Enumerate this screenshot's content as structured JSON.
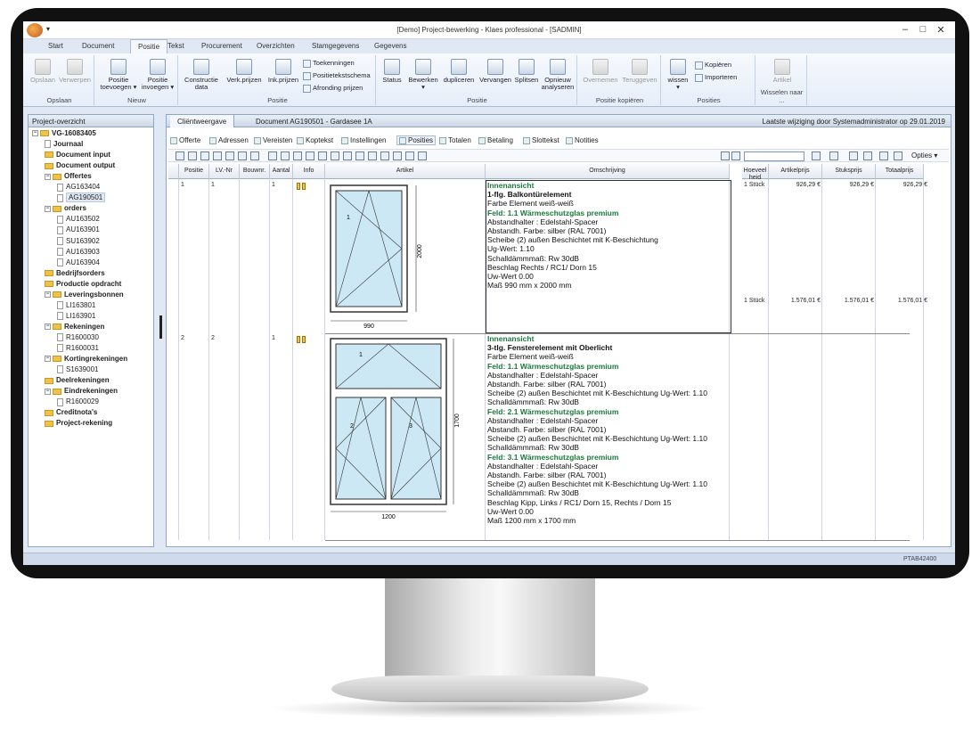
{
  "window": {
    "title": "[Demo] Project-bewerking - Klaes professional - [SADMIN]",
    "quick_access": "▾"
  },
  "menu_tabs": [
    "Start",
    "Document",
    "Positie",
    "Tekst",
    "Procurement",
    "Overzichten",
    "Stamgegevens",
    "Gegevens"
  ],
  "ribbon": {
    "buttons": {
      "opslaan": "Opslaan",
      "verwerpen": "Verwerpen",
      "positie_toevoegen": "Positie\ntoevoegen ▾",
      "positie_invoegen": "Positie\ninvoegen ▾",
      "constructie_data": "Constructie\ndata",
      "verk_prijzen": "Verk.prijzen",
      "ink_prijzen": "Ink.prijzen",
      "toekenningen": "Toekenningen",
      "positietekstschema": "Positietekstschema",
      "afronding_prijzen": "Afronding prijzen",
      "status": "Status",
      "bewerken": "Bewerken\n▾",
      "dupliceren": "dupliceren",
      "vervangen": "Vervangen",
      "splitsen": "Splitsen",
      "opnieuw_analyseren": "Opnieuw\nanalyseren",
      "overnemen": "Overnemen",
      "teruggeven": "Teruggeven",
      "wissen": "wissen\n▾",
      "kopieren": "Kopiëren",
      "importeren": "Importeren",
      "artikel": "Artikel"
    },
    "groups": {
      "opslaan": "Opslaan",
      "nieuw": "Nieuw",
      "positie": "Positie",
      "positie2": "Positie",
      "positie_kopieren": "Positie kopiëren",
      "posities": "Posities",
      "wisselen": "Wisselen naar ..."
    }
  },
  "left_panel": {
    "title": "Project-overzicht",
    "tree": [
      {
        "label": "VG-16083405",
        "level": 0,
        "bold": true,
        "folder": true,
        "box": "−"
      },
      {
        "label": "Journaal",
        "level": 1,
        "bold": true,
        "folder": false
      },
      {
        "label": "Document input",
        "level": 1,
        "bold": true,
        "folder": true
      },
      {
        "label": "Document output",
        "level": 1,
        "bold": true,
        "folder": true
      },
      {
        "label": "Offertes",
        "level": 1,
        "bold": true,
        "folder": true,
        "box": "−"
      },
      {
        "label": "AG163404",
        "level": 2,
        "bold": false,
        "folder": false
      },
      {
        "label": "AG190501",
        "level": 2,
        "bold": false,
        "folder": false,
        "selected": true
      },
      {
        "label": "orders",
        "level": 1,
        "bold": true,
        "folder": true,
        "box": "−"
      },
      {
        "label": "AU163502",
        "level": 2,
        "bold": false,
        "folder": false
      },
      {
        "label": "AU163901",
        "level": 2,
        "bold": false,
        "folder": false
      },
      {
        "label": "SU163902",
        "level": 2,
        "bold": false,
        "folder": false
      },
      {
        "label": "AU163903",
        "level": 2,
        "bold": false,
        "folder": false
      },
      {
        "label": "AU163904",
        "level": 2,
        "bold": false,
        "folder": false
      },
      {
        "label": "Bedrijfsorders",
        "level": 1,
        "bold": true,
        "folder": true
      },
      {
        "label": "Productie opdracht",
        "level": 1,
        "bold": true,
        "folder": true
      },
      {
        "label": "Leveringsbonnen",
        "level": 1,
        "bold": true,
        "folder": true,
        "box": "−"
      },
      {
        "label": "LI163801",
        "level": 2,
        "bold": false,
        "folder": false
      },
      {
        "label": "LI163901",
        "level": 2,
        "bold": false,
        "folder": false
      },
      {
        "label": "Rekeningen",
        "level": 1,
        "bold": true,
        "folder": true,
        "box": "−"
      },
      {
        "label": "R1600030",
        "level": 2,
        "bold": false,
        "folder": false
      },
      {
        "label": "R1600031",
        "level": 2,
        "bold": false,
        "folder": false
      },
      {
        "label": "Kortingrekeningen",
        "level": 1,
        "bold": true,
        "folder": true,
        "box": "−"
      },
      {
        "label": "S1639001",
        "level": 2,
        "bold": false,
        "folder": false
      },
      {
        "label": "Deelrekeningen",
        "level": 1,
        "bold": true,
        "folder": true
      },
      {
        "label": "Eindrekeningen",
        "level": 1,
        "bold": true,
        "folder": true,
        "box": "−"
      },
      {
        "label": "R1600029",
        "level": 2,
        "bold": false,
        "folder": false
      },
      {
        "label": "Creditnota's",
        "level": 1,
        "bold": true,
        "folder": true
      },
      {
        "label": "Project-rekening",
        "level": 1,
        "bold": true,
        "folder": true
      }
    ]
  },
  "main": {
    "view_tab": "Cliëntweergave",
    "document": "Document AG190501 - Gardasee 1A",
    "last_change": "Laatste wijziging door Systemadministrator op 29.01.2019",
    "subtabs": [
      "Offerte",
      "Adressen",
      "Vereisten",
      "Koptekst",
      "Instellingen",
      "Posities",
      "Totalen",
      "Betaling",
      "Slottekst",
      "Notities"
    ],
    "options": "Opties ▾",
    "columns": {
      "positie": "Positie",
      "lvnr": "LV.-Nr",
      "bouwnr": "Bouwnr.",
      "aantal": "Aantal",
      "info": "Info",
      "artikel": "Artikel",
      "omschrijving": "Omschrijving",
      "hoeveelheid": "Hoeveel heid",
      "artikelprijs": "Artikelprijs",
      "stuksprijs": "Stuksprijs",
      "totaalprijs": "Totaalprijs"
    },
    "rows": [
      {
        "positie": "1",
        "lvnr": "1",
        "aantal": "1",
        "dims": {
          "w": "990",
          "h": "2000"
        },
        "panels": [
          "1"
        ],
        "desc": {
          "head": "Innenansicht",
          "title": "1-flg. Balkontürelement",
          "lines": [
            "Farbe Element  weiß-weiß",
            "Feld: 1.1 Wärmeschutzglas premium",
            "Abstandhalter : Edelstahl-Spacer",
            "Abstandh. Farbe: silber (RAL 7001)",
            "Scheibe (2) außen Beschichtet mit K-Beschichtung",
            "Ug-Wert: 1.10",
            "Schalldämmmaß: Rw 30dB",
            "Beschlag          Rechts / RC1/ Dorn 15",
            "Uw-Wert            0.00",
            "Maß                  990 mm x 2000 mm"
          ]
        },
        "prices": [
          {
            "qty": "1 Stück",
            "art": "926,29 €",
            "stuk": "926,29 €",
            "tot": "926,29 €"
          },
          {
            "qty": "1 Stück",
            "art": "1.576,01 €",
            "stuk": "1.576,01 €",
            "tot": "1.576,01 €"
          }
        ]
      },
      {
        "positie": "2",
        "lvnr": "2",
        "aantal": "1",
        "dims": {
          "w": "1200",
          "h": "1700"
        },
        "panels": [
          "1",
          "2",
          "3"
        ],
        "desc": {
          "head": "Innenansicht",
          "title": "3-tlg. Fensterelement mit Oberlicht",
          "lines": [
            "Farbe Element  weiß-weiß",
            "Feld: 1.1 Wärmeschutzglas premium",
            "Abstandhalter : Edelstahl-Spacer",
            "Abstandh. Farbe: silber (RAL 7001)",
            "Scheibe (2) außen Beschichtet mit K-Beschichtung  Ug-Wert: 1.10",
            "Schalldämmmaß: Rw 30dB",
            "Feld: 2.1 Wärmeschutzglas premium",
            "Abstandhalter : Edelstahl-Spacer",
            "Abstandh. Farbe: silber (RAL 7001)",
            "Scheibe (2) außen Beschichtet mit K-Beschichtung  Ug-Wert: 1.10",
            "Schalldämmmaß: Rw 30dB",
            "Feld: 3.1 Wärmeschutzglas premium",
            "Abstandhalter : Edelstahl-Spacer",
            "Abstandh. Farbe: silber (RAL 7001)",
            "Scheibe (2) außen Beschichtet mit K-Beschichtung  Ug-Wert: 1.10",
            "Schalldämmmaß: Rw 30dB",
            "Beschlag          Kipp, Links / RC1/ Dorn 15, Rechts / Dorn 15",
            "Uw-Wert            0.00",
            "Maß                  1200 mm x 1700 mm"
          ]
        }
      }
    ]
  },
  "status": {
    "code": "PTAB42400"
  },
  "colors": {
    "accent": "#1a7a3a",
    "ribbon": "#e6eef8",
    "glass": "#cde8f5"
  }
}
